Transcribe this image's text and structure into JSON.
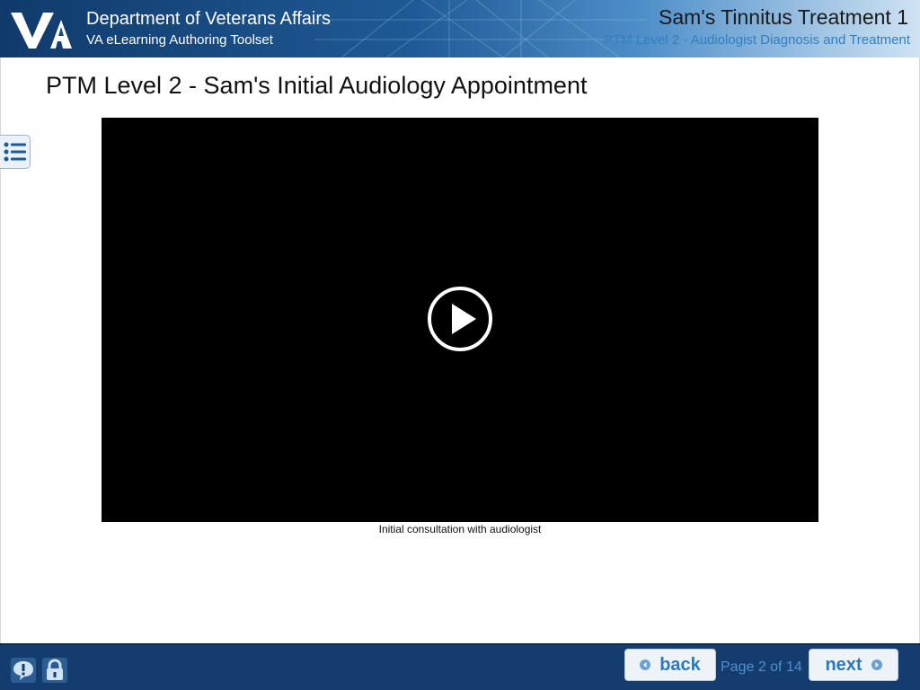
{
  "header": {
    "org_title": "Department of Veterans Affairs",
    "org_subtitle": "VA eLearning Authoring Toolset",
    "course_title": "Sam's Tinnitus Treatment 1",
    "course_subtitle": "PTM Level 2 - Audiologist Diagnosis and Treatment",
    "logo_icon": "va-logo-icon"
  },
  "page": {
    "title": "PTM Level 2 - Sam's Initial Audiology Appointment",
    "menu_icon": "list-menu-icon"
  },
  "video": {
    "play_icon": "play-icon",
    "caption": "Initial consultation with audiologist"
  },
  "footer": {
    "help_icon": "help-icon",
    "lock_icon": "lock-icon",
    "back_label": "back",
    "next_label": "next",
    "page_indicator": "Page 2 of 14"
  },
  "colors": {
    "header_dark": "#103a6b",
    "footer_bg": "#143d6d",
    "accent_blue": "#2f7fc3"
  }
}
